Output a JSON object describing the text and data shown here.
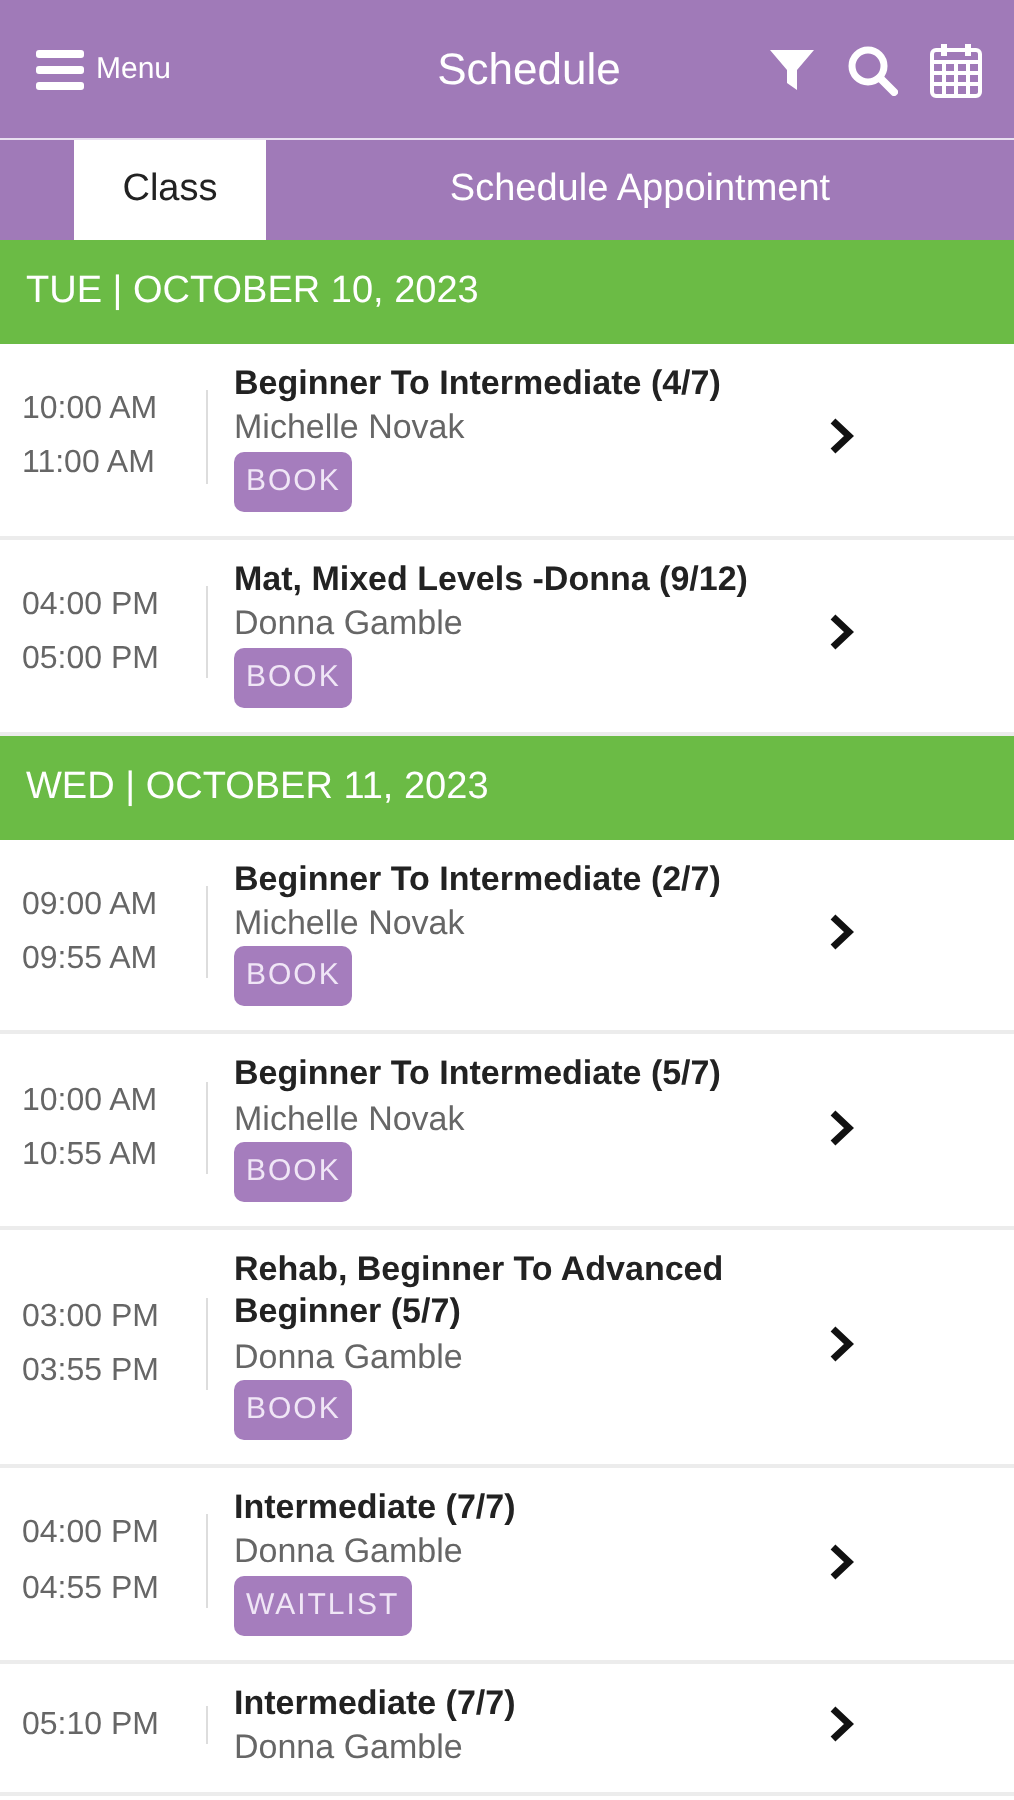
{
  "header": {
    "menu_label": "Menu",
    "title": "Schedule"
  },
  "tabs": [
    {
      "label": "Class",
      "selected": true
    },
    {
      "label": "Schedule Appointment",
      "selected": false
    }
  ],
  "days": [
    {
      "date": "TUE | OCTOBER 10, 2023",
      "classes": [
        {
          "start": "10:00 AM",
          "end": "11:00 AM",
          "title": "Beginner To Intermediate (4/7)",
          "instructor": "Michelle Novak",
          "action": "BOOK"
        },
        {
          "start": "04:00 PM",
          "end": "05:00 PM",
          "title": "Mat, Mixed Levels -Donna (9/12)",
          "instructor": "Donna Gamble",
          "action": "BOOK"
        }
      ]
    },
    {
      "date": "WED | OCTOBER 11, 2023",
      "classes": [
        {
          "start": "09:00 AM",
          "end": "09:55 AM",
          "title": "Beginner To Intermediate (2/7)",
          "instructor": "Michelle Novak",
          "action": "BOOK"
        },
        {
          "start": "10:00 AM",
          "end": "10:55 AM",
          "title": "Beginner To Intermediate (5/7)",
          "instructor": "Michelle Novak",
          "action": "BOOK"
        },
        {
          "start": "03:00 PM",
          "end": "03:55 PM",
          "title": "Rehab, Beginner To Advanced Beginner (5/7)",
          "instructor": "Donna Gamble",
          "action": "BOOK"
        },
        {
          "start": "04:00 PM",
          "end": "04:55 PM",
          "title": "Intermediate (7/7)",
          "instructor": "Donna Gamble",
          "action": "WAITLIST"
        },
        {
          "start": "05:10 PM",
          "title": "Intermediate (7/7)",
          "instructor": "Donna Gamble"
        }
      ]
    }
  ]
}
